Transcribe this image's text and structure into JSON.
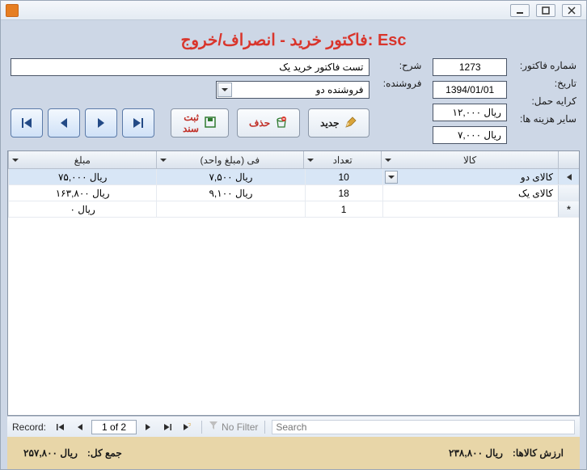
{
  "title": "فاکتور خرید - انصراف/خروج: Esc",
  "labels": {
    "invoiceNo": "شماره فاکتور:",
    "date": "تاریخ:",
    "freight": "کرایه حمل:",
    "otherCosts": "سایر هزینه ها:",
    "desc": "شرح:",
    "seller": "فروشنده:"
  },
  "fields": {
    "invoiceNo": "1273",
    "date": "1394/01/01",
    "freight": "ریال ۱۲,۰۰۰",
    "otherCosts": "ریال ۷,۰۰۰",
    "desc": "تست فاکتور خرید یک",
    "seller": "فروشنده دو"
  },
  "buttons": {
    "new": "جدید",
    "delete": "حذف",
    "save": "ثبت سند"
  },
  "columns": {
    "item": "کالا",
    "qty": "تعداد",
    "unitPrice": "فی (مبلغ واحد)",
    "amount": "مبلغ"
  },
  "rows": [
    {
      "item": "کالای دو",
      "qty": "10",
      "unitPrice": "ریال ۷,۵۰۰",
      "amount": "ریال ۷۵,۰۰۰",
      "selected": true,
      "dd": true
    },
    {
      "item": "کالای یک",
      "qty": "18",
      "unitPrice": "ریال ۹,۱۰۰",
      "amount": "ریال ۱۶۳,۸۰۰",
      "selected": false,
      "dd": false
    },
    {
      "item": "",
      "qty": "1",
      "unitPrice": "",
      "amount": "ریال ۰",
      "selected": false,
      "dd": false,
      "new": true
    }
  ],
  "recordNav": {
    "label": "Record:",
    "position": "1 of 2",
    "filter": "No Filter",
    "searchPlaceholder": "Search"
  },
  "footer": {
    "goodsValueLabel": "ارزش کالاها:",
    "goodsValue": "ریال ۲۳۸,۸۰۰",
    "grandTotalLabel": "جمع کل:",
    "grandTotal": "ریال ۲۵۷,۸۰۰"
  }
}
